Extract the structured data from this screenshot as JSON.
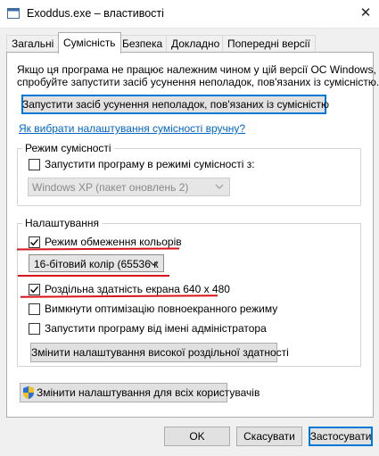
{
  "window": {
    "title": "Exoddus.exe – властивості",
    "close_glyph": "✕"
  },
  "tabs": [
    {
      "label": "Загальні"
    },
    {
      "label": "Сумісність"
    },
    {
      "label": "Безпека"
    },
    {
      "label": "Докладно"
    },
    {
      "label": "Попередні версії"
    }
  ],
  "compat": {
    "intro": [
      "Якщо ця програма не працює належним чином у цій версії ОС Windows,",
      "спробуйте запустити засіб усунення неполадок, пов'язаних із сумісністю."
    ],
    "troubleshooter_button": "Запустити засіб усунення неполадок, пов'язаних із сумісністю",
    "manual_link": "Як вибрати налаштування сумісності вручну?",
    "mode_group": {
      "legend": "Режим сумісності",
      "checkbox_label": "Запустити програму в режимі сумісності з:",
      "checked": false,
      "os_select": "Windows XP (пакет оновлень 2)"
    },
    "settings_group": {
      "legend": "Налаштування",
      "reduced_color": {
        "label": "Режим обмеження кольорів",
        "checked": true
      },
      "color_select": "16-бітовий колір (65536 к",
      "res_640": {
        "label": "Роздільна здатність екрана 640 x 480",
        "checked": true
      },
      "fullscreen_opt": {
        "label": "Вимкнути оптимізацію повноекранного режиму",
        "checked": false
      },
      "run_admin": {
        "label": "Запустити програму від імені адміністратора",
        "checked": false
      },
      "high_dpi_button": "Змінити налаштування високої роздільної здатності"
    },
    "all_users_button": "Змінити налаштування для всіх користувачів"
  },
  "footer": {
    "ok": "OK",
    "cancel": "Скасувати",
    "apply": "Застосувати"
  },
  "colors": {
    "annotation_red": "#d7141a",
    "focus_blue": "#0078d7",
    "link_blue": "#0066cc"
  }
}
